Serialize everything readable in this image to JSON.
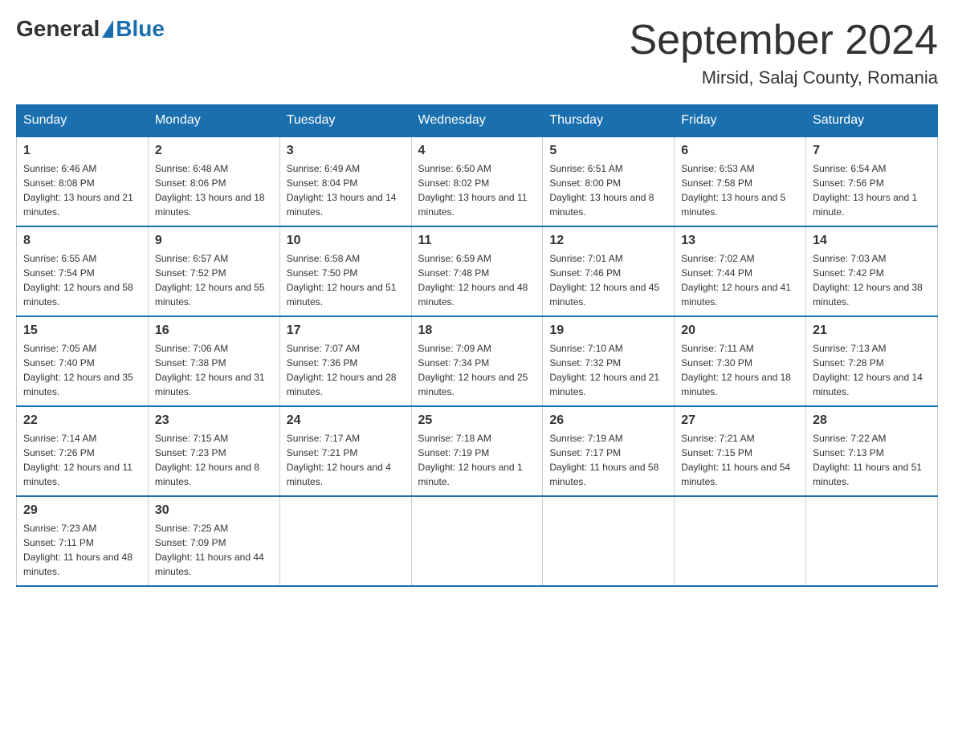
{
  "header": {
    "logo_text_general": "General",
    "logo_text_blue": "Blue",
    "month_title": "September 2024",
    "location": "Mirsid, Salaj County, Romania"
  },
  "weekdays": [
    "Sunday",
    "Monday",
    "Tuesday",
    "Wednesday",
    "Thursday",
    "Friday",
    "Saturday"
  ],
  "weeks": [
    [
      {
        "day": "1",
        "sunrise": "Sunrise: 6:46 AM",
        "sunset": "Sunset: 8:08 PM",
        "daylight": "Daylight: 13 hours and 21 minutes."
      },
      {
        "day": "2",
        "sunrise": "Sunrise: 6:48 AM",
        "sunset": "Sunset: 8:06 PM",
        "daylight": "Daylight: 13 hours and 18 minutes."
      },
      {
        "day": "3",
        "sunrise": "Sunrise: 6:49 AM",
        "sunset": "Sunset: 8:04 PM",
        "daylight": "Daylight: 13 hours and 14 minutes."
      },
      {
        "day": "4",
        "sunrise": "Sunrise: 6:50 AM",
        "sunset": "Sunset: 8:02 PM",
        "daylight": "Daylight: 13 hours and 11 minutes."
      },
      {
        "day": "5",
        "sunrise": "Sunrise: 6:51 AM",
        "sunset": "Sunset: 8:00 PM",
        "daylight": "Daylight: 13 hours and 8 minutes."
      },
      {
        "day": "6",
        "sunrise": "Sunrise: 6:53 AM",
        "sunset": "Sunset: 7:58 PM",
        "daylight": "Daylight: 13 hours and 5 minutes."
      },
      {
        "day": "7",
        "sunrise": "Sunrise: 6:54 AM",
        "sunset": "Sunset: 7:56 PM",
        "daylight": "Daylight: 13 hours and 1 minute."
      }
    ],
    [
      {
        "day": "8",
        "sunrise": "Sunrise: 6:55 AM",
        "sunset": "Sunset: 7:54 PM",
        "daylight": "Daylight: 12 hours and 58 minutes."
      },
      {
        "day": "9",
        "sunrise": "Sunrise: 6:57 AM",
        "sunset": "Sunset: 7:52 PM",
        "daylight": "Daylight: 12 hours and 55 minutes."
      },
      {
        "day": "10",
        "sunrise": "Sunrise: 6:58 AM",
        "sunset": "Sunset: 7:50 PM",
        "daylight": "Daylight: 12 hours and 51 minutes."
      },
      {
        "day": "11",
        "sunrise": "Sunrise: 6:59 AM",
        "sunset": "Sunset: 7:48 PM",
        "daylight": "Daylight: 12 hours and 48 minutes."
      },
      {
        "day": "12",
        "sunrise": "Sunrise: 7:01 AM",
        "sunset": "Sunset: 7:46 PM",
        "daylight": "Daylight: 12 hours and 45 minutes."
      },
      {
        "day": "13",
        "sunrise": "Sunrise: 7:02 AM",
        "sunset": "Sunset: 7:44 PM",
        "daylight": "Daylight: 12 hours and 41 minutes."
      },
      {
        "day": "14",
        "sunrise": "Sunrise: 7:03 AM",
        "sunset": "Sunset: 7:42 PM",
        "daylight": "Daylight: 12 hours and 38 minutes."
      }
    ],
    [
      {
        "day": "15",
        "sunrise": "Sunrise: 7:05 AM",
        "sunset": "Sunset: 7:40 PM",
        "daylight": "Daylight: 12 hours and 35 minutes."
      },
      {
        "day": "16",
        "sunrise": "Sunrise: 7:06 AM",
        "sunset": "Sunset: 7:38 PM",
        "daylight": "Daylight: 12 hours and 31 minutes."
      },
      {
        "day": "17",
        "sunrise": "Sunrise: 7:07 AM",
        "sunset": "Sunset: 7:36 PM",
        "daylight": "Daylight: 12 hours and 28 minutes."
      },
      {
        "day": "18",
        "sunrise": "Sunrise: 7:09 AM",
        "sunset": "Sunset: 7:34 PM",
        "daylight": "Daylight: 12 hours and 25 minutes."
      },
      {
        "day": "19",
        "sunrise": "Sunrise: 7:10 AM",
        "sunset": "Sunset: 7:32 PM",
        "daylight": "Daylight: 12 hours and 21 minutes."
      },
      {
        "day": "20",
        "sunrise": "Sunrise: 7:11 AM",
        "sunset": "Sunset: 7:30 PM",
        "daylight": "Daylight: 12 hours and 18 minutes."
      },
      {
        "day": "21",
        "sunrise": "Sunrise: 7:13 AM",
        "sunset": "Sunset: 7:28 PM",
        "daylight": "Daylight: 12 hours and 14 minutes."
      }
    ],
    [
      {
        "day": "22",
        "sunrise": "Sunrise: 7:14 AM",
        "sunset": "Sunset: 7:26 PM",
        "daylight": "Daylight: 12 hours and 11 minutes."
      },
      {
        "day": "23",
        "sunrise": "Sunrise: 7:15 AM",
        "sunset": "Sunset: 7:23 PM",
        "daylight": "Daylight: 12 hours and 8 minutes."
      },
      {
        "day": "24",
        "sunrise": "Sunrise: 7:17 AM",
        "sunset": "Sunset: 7:21 PM",
        "daylight": "Daylight: 12 hours and 4 minutes."
      },
      {
        "day": "25",
        "sunrise": "Sunrise: 7:18 AM",
        "sunset": "Sunset: 7:19 PM",
        "daylight": "Daylight: 12 hours and 1 minute."
      },
      {
        "day": "26",
        "sunrise": "Sunrise: 7:19 AM",
        "sunset": "Sunset: 7:17 PM",
        "daylight": "Daylight: 11 hours and 58 minutes."
      },
      {
        "day": "27",
        "sunrise": "Sunrise: 7:21 AM",
        "sunset": "Sunset: 7:15 PM",
        "daylight": "Daylight: 11 hours and 54 minutes."
      },
      {
        "day": "28",
        "sunrise": "Sunrise: 7:22 AM",
        "sunset": "Sunset: 7:13 PM",
        "daylight": "Daylight: 11 hours and 51 minutes."
      }
    ],
    [
      {
        "day": "29",
        "sunrise": "Sunrise: 7:23 AM",
        "sunset": "Sunset: 7:11 PM",
        "daylight": "Daylight: 11 hours and 48 minutes."
      },
      {
        "day": "30",
        "sunrise": "Sunrise: 7:25 AM",
        "sunset": "Sunset: 7:09 PM",
        "daylight": "Daylight: 11 hours and 44 minutes."
      },
      null,
      null,
      null,
      null,
      null
    ]
  ]
}
